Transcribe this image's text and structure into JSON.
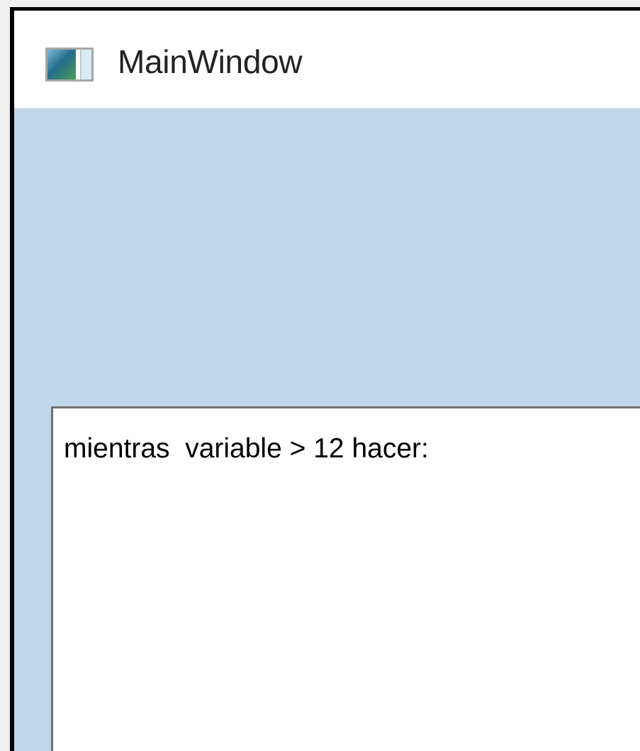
{
  "window": {
    "title": "MainWindow",
    "icon": "window-app-icon"
  },
  "editor": {
    "content": "mientras  variable > 12 hacer:"
  },
  "colors": {
    "client_background": "#c0d6ea",
    "titlebar_background": "#ffffff",
    "editor_border": "#707070"
  }
}
